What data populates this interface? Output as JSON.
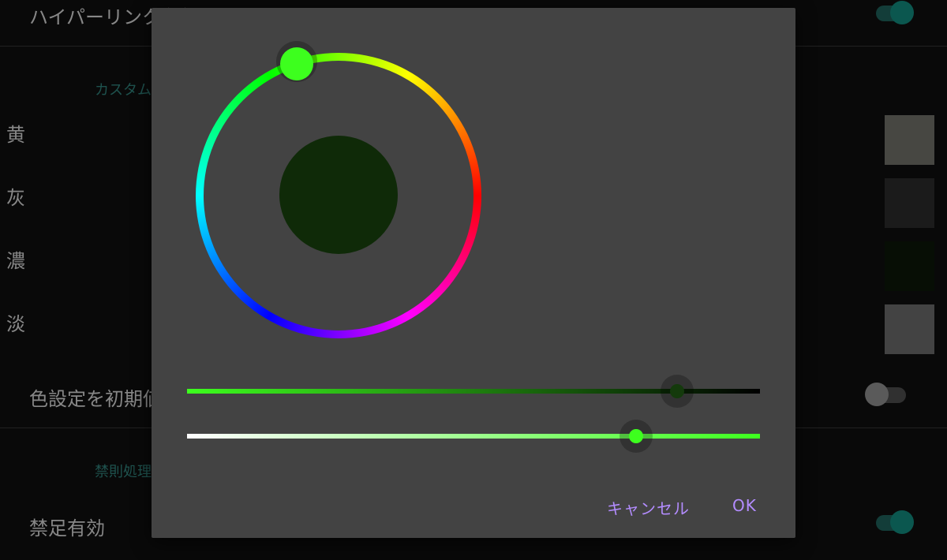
{
  "settings": {
    "hyperlink_label": "ハイパーリンク有効",
    "custom_section": "カスタム",
    "colors": [
      {
        "label": "黄",
        "swatch": "#6d6d66"
      },
      {
        "label": "灰",
        "swatch": "#2a2a2a"
      },
      {
        "label": "濃",
        "swatch": "#0b1608"
      },
      {
        "label": "淡",
        "swatch": "#686868"
      }
    ],
    "reset_label": "色設定を初期値",
    "prohibit_section": "禁則処理",
    "prohibit_label": "禁足有効",
    "toggles": {
      "hyperlink": "on",
      "reset": "off",
      "prohibit": "on"
    }
  },
  "dialog": {
    "selected_hue_color": "#3dff1e",
    "preview_color": "#0f2a08",
    "saturation_value_slider": {
      "value": 0.855,
      "knob_color": "#143a0c"
    },
    "lightness_slider": {
      "value": 0.784,
      "knob_color": "#3dff1e"
    },
    "cancel_label": "キャンセル",
    "ok_label": "OK"
  }
}
